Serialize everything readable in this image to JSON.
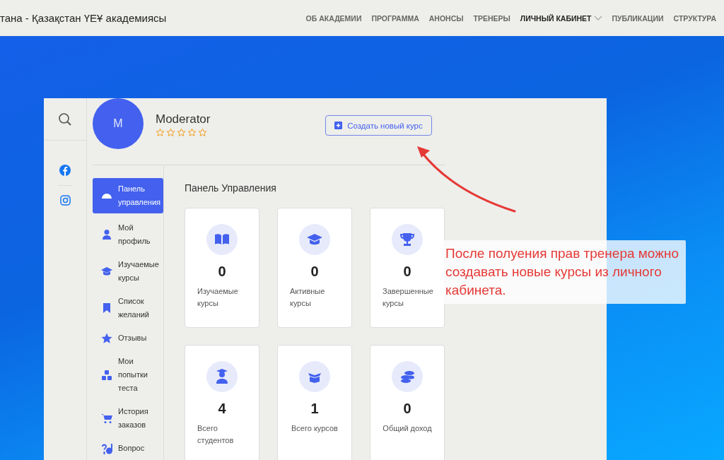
{
  "header": {
    "site_title": "тана - Қазақстан ҮЕҰ академиясы",
    "nav": [
      {
        "label": "ОБ АКАДЕМИИ",
        "selected": false,
        "has_dropdown": false
      },
      {
        "label": "ПРОГРАММА",
        "selected": false,
        "has_dropdown": false
      },
      {
        "label": "АНОНСЫ",
        "selected": false,
        "has_dropdown": false
      },
      {
        "label": "ТРЕНЕРЫ",
        "selected": false,
        "has_dropdown": false
      },
      {
        "label": "ЛИЧНЫЙ КАБИНЕТ",
        "selected": true,
        "has_dropdown": true
      },
      {
        "label": "ПУБЛИКАЦИИ",
        "selected": false,
        "has_dropdown": false
      },
      {
        "label": "СТРУКТУРА",
        "selected": false,
        "has_dropdown": false
      }
    ]
  },
  "profile": {
    "avatar_letter": "M",
    "name": "Moderator",
    "stars": 0,
    "create_button": "Создать новый курс"
  },
  "sidebar": {
    "items": [
      {
        "label": "Панель управления",
        "kind": "gauge",
        "selected": true
      },
      {
        "label": "Мой профиль",
        "kind": "user",
        "selected": false
      },
      {
        "label": "Изучаемые курсы",
        "kind": "cap",
        "selected": false
      },
      {
        "label": "Список желаний",
        "kind": "bookmark",
        "selected": false
      },
      {
        "label": "Отзывы",
        "kind": "star",
        "selected": false
      },
      {
        "label": "Мои попытки теста",
        "kind": "blocks",
        "selected": false
      },
      {
        "label": "История заказов",
        "kind": "cart",
        "selected": false
      },
      {
        "label": "Вопрос",
        "kind": "question",
        "selected": false
      }
    ]
  },
  "dashboard": {
    "title": "Панель Управления",
    "cards": [
      {
        "kind": "book",
        "value": "0",
        "label": "Изучаемые курсы"
      },
      {
        "kind": "cap",
        "value": "0",
        "label": "Активные курсы"
      },
      {
        "kind": "trophy",
        "value": "0",
        "label": "Завершенные курсы"
      },
      {
        "kind": "student",
        "value": "4",
        "label": "Всего студентов"
      },
      {
        "kind": "box",
        "value": "1",
        "label": "Всего курсов"
      },
      {
        "kind": "coins",
        "value": "0",
        "label": "Общий доход"
      }
    ]
  },
  "annotation": {
    "text": "После полуения прав тренера можно создавать новые курсы из личного кабинета."
  }
}
